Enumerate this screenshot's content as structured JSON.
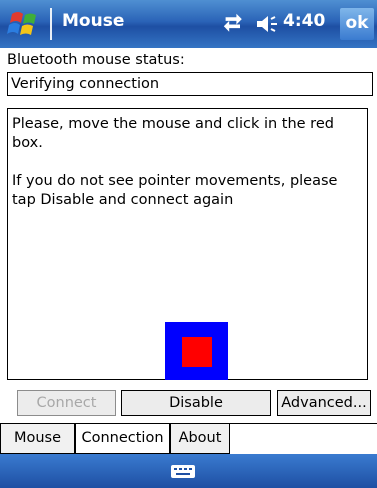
{
  "titlebar": {
    "app_title": "Mouse",
    "clock": "4:40",
    "ok_label": "ok"
  },
  "status": {
    "label": "Bluetooth mouse status:",
    "value": "Verifying connection"
  },
  "message": {
    "text": "Please, move the mouse and click in the red box.\n\nIf you do not see pointer movements, please tap Disable and connect again"
  },
  "buttons": {
    "connect": "Connect",
    "disable": "Disable",
    "advanced": "Advanced..."
  },
  "tabs": [
    {
      "label": "Mouse"
    },
    {
      "label": "Connection"
    },
    {
      "label": "About"
    }
  ],
  "colors": {
    "titlebar": "#2a63b7",
    "target_outer": "#0000ff",
    "target_inner": "#ff0000"
  },
  "icons": {
    "start": "windows-flag-icon",
    "connectivity": "connectivity-icon",
    "volume": "volume-icon",
    "keyboard": "keyboard-icon"
  }
}
